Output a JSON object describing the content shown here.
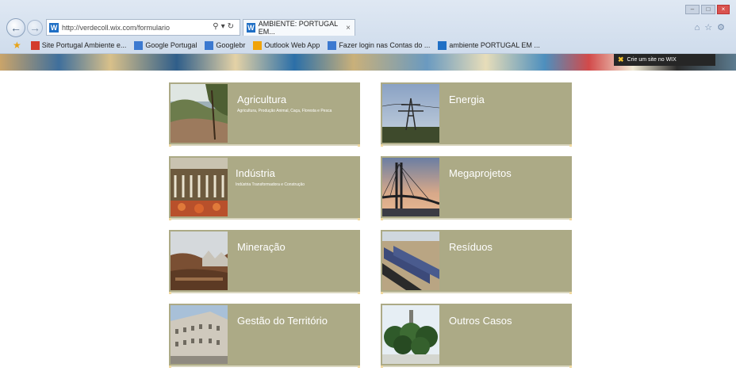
{
  "browser": {
    "address": "http://verdecoll.wix.com/formulario",
    "address_favicon": "W",
    "tab_title": "AMBIENTE: PORTUGAL EM...",
    "tab_close": "×",
    "favorites": [
      {
        "label": "Site Portugal Ambiente e...",
        "icon": "pdf-icon",
        "color": "#d33b2c"
      },
      {
        "label": "Google Portugal",
        "icon": "page-icon",
        "color": "#3b79d0"
      },
      {
        "label": "Googlebr",
        "icon": "page-icon",
        "color": "#3b79d0"
      },
      {
        "label": "Outlook Web App",
        "icon": "outlook-icon",
        "color": "#f0a30a"
      },
      {
        "label": "Fazer login nas Contas do ...",
        "icon": "page-icon",
        "color": "#3b79d0"
      },
      {
        "label": "ambiente PORTUGAL EM ...",
        "icon": "wix-icon",
        "color": "#1f6fc5"
      }
    ]
  },
  "wix_badge": {
    "label": "Crie um site no WIX"
  },
  "cards": [
    {
      "title": "Agricultura",
      "subtitle": "Agricultura, Produção Animal, Caça, Floresta e Pesca",
      "thumb": "agriculture"
    },
    {
      "title": "Energia",
      "subtitle": "",
      "thumb": "energy"
    },
    {
      "title": "Indústria",
      "subtitle": "Indústria Transformadora e Construção",
      "thumb": "industry"
    },
    {
      "title": "Megaprojetos",
      "subtitle": "",
      "thumb": "bridge"
    },
    {
      "title": "Mineração",
      "subtitle": "",
      "thumb": "mining"
    },
    {
      "title": "Resíduos",
      "subtitle": "",
      "thumb": "waste"
    },
    {
      "title": "Gestão do Território",
      "subtitle": "",
      "thumb": "building"
    },
    {
      "title": "Outros Casos",
      "subtitle": "",
      "thumb": "trees"
    }
  ],
  "colors": {
    "card_bg": "#acaa86",
    "page_bg": "#ffffff"
  }
}
